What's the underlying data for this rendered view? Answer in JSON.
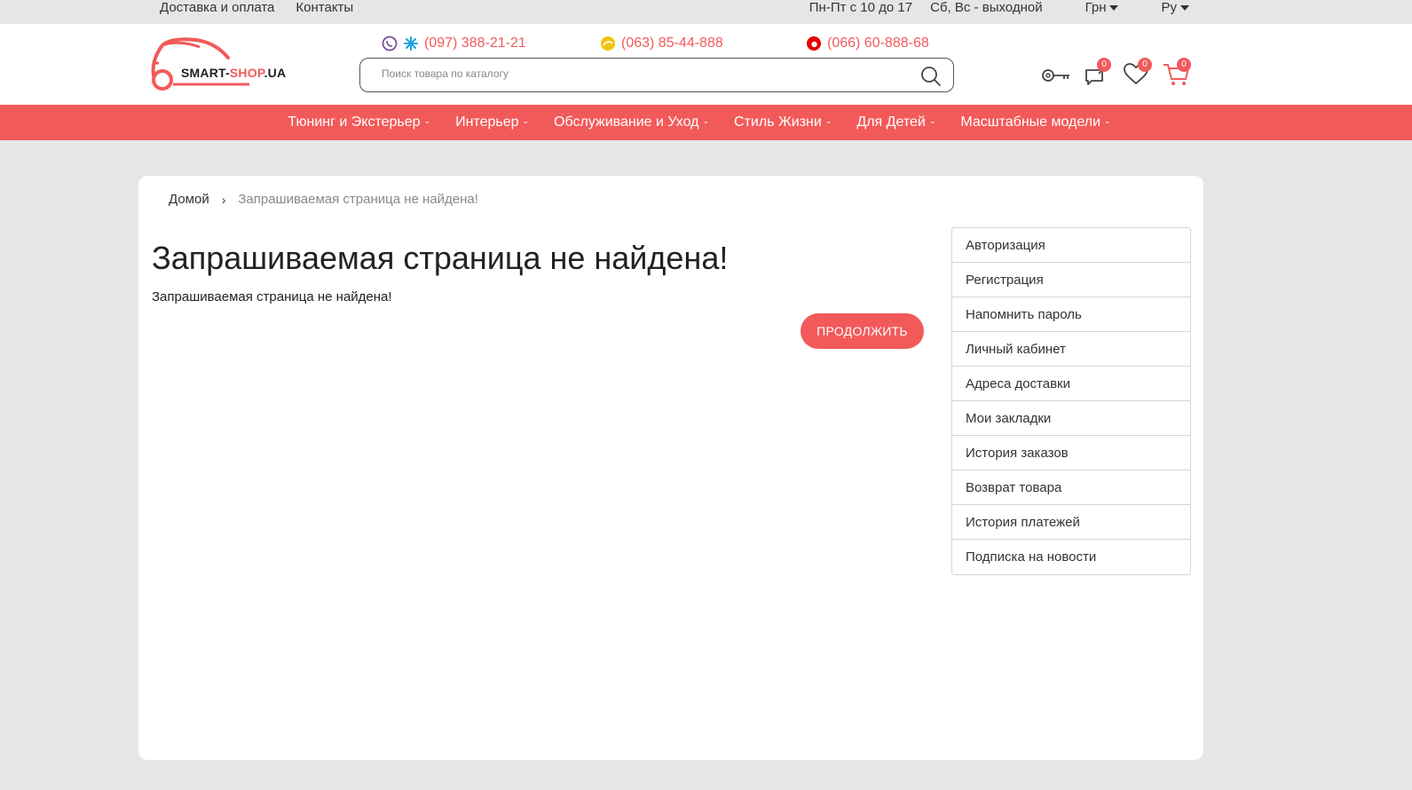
{
  "topbar": {
    "links": [
      "Доставка и оплата",
      "Контакты"
    ],
    "hours_weekdays": "Пн-Пт с 10 до 17",
    "hours_weekend": "Сб, Вс - выходной",
    "currency": "Грн",
    "language": "Ру"
  },
  "header": {
    "logo_main": "SMART-",
    "logo_accent": "SHOP",
    "logo_tail": ".UA",
    "phones": [
      {
        "number": "(097) 388-21-21",
        "icons": [
          "viber-icon",
          "kyivstar-icon"
        ]
      },
      {
        "number": "(063) 85-44-888",
        "icons": [
          "lifecell-icon"
        ]
      },
      {
        "number": "(066) 60-888-68",
        "icons": [
          "vodafone-icon"
        ]
      }
    ],
    "search_placeholder": "Поиск товара по каталогу",
    "compare_count": "0",
    "wishlist_count": "0",
    "cart_count": "0"
  },
  "nav": {
    "items": [
      "Тюнинг и Экстерьер",
      "Интерьер",
      "Обслуживание и Уход",
      "Стиль Жизни",
      "Для Детей",
      "Масштабные модели"
    ]
  },
  "breadcrumb": {
    "home": "Домой",
    "separator": "›",
    "current": "Запрашиваемая страница не найдена!"
  },
  "main": {
    "title": "Запрашиваемая страница не найдена!",
    "message": "Запрашиваемая страница не найдена!",
    "continue_label": "ПРОДОЛЖИТЬ"
  },
  "sidebar": {
    "items": [
      "Авторизация",
      "Регистрация",
      "Напомнить пароль",
      "Личный кабинет",
      "Адреса доставки",
      "Мои закладки",
      "История заказов",
      "Возврат товара",
      "История платежей",
      "Подписка на новости"
    ]
  },
  "colors": {
    "accent": "#f25a5a",
    "page_bg": "#e6e6e6",
    "card_bg": "#ffffff"
  }
}
